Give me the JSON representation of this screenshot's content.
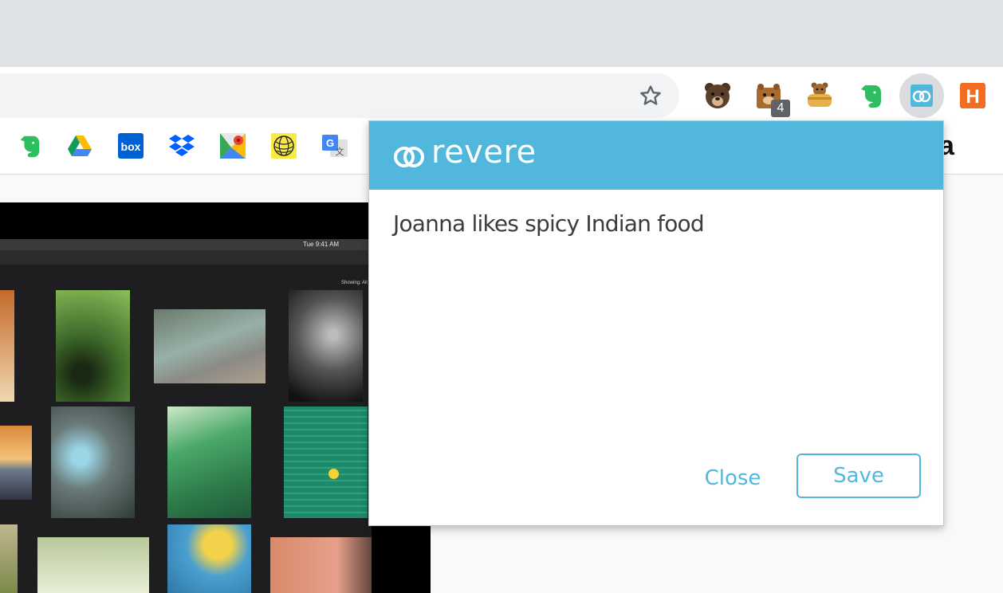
{
  "toolbar": {
    "bookmark_star_icon": "star-outline",
    "extensions": [
      {
        "name": "bear-extension-icon",
        "icon": "brown-bear"
      },
      {
        "name": "tunnelbear-extension-icon",
        "icon": "bear-in-box",
        "badge": "4"
      },
      {
        "name": "honeybear-extension-icon",
        "icon": "bear-in-pot"
      },
      {
        "name": "evernote-extension-icon",
        "icon": "green-elephant"
      },
      {
        "name": "revere-extension-icon",
        "icon": "revere-heart",
        "active": true
      },
      {
        "name": "honey-extension-icon",
        "icon": "orange-h",
        "letter": "H"
      }
    ]
  },
  "bookmarks": {
    "items": [
      {
        "name": "bookmark-evernote",
        "icon": "evernote-icon"
      },
      {
        "name": "bookmark-google-drive",
        "icon": "google-drive-icon"
      },
      {
        "name": "bookmark-box",
        "icon": "box-icon",
        "text": "box"
      },
      {
        "name": "bookmark-dropbox",
        "icon": "dropbox-icon"
      },
      {
        "name": "bookmark-google-maps",
        "icon": "google-maps-icon"
      },
      {
        "name": "bookmark-globe",
        "icon": "globe-icon"
      },
      {
        "name": "bookmark-google-translate",
        "icon": "google-translate-icon"
      }
    ],
    "amazon_partial": "a"
  },
  "background_screenshot": {
    "clock": "Tue 9:41 AM",
    "showing_label": "Showing: All"
  },
  "popup": {
    "brand": "revere",
    "note": "Joanna likes spicy Indian food",
    "close_label": "Close",
    "save_label": "Save"
  },
  "colors": {
    "accent": "#52b7dd",
    "tabstrip": "#dee1e6",
    "omnibox": "#f1f3f4"
  }
}
